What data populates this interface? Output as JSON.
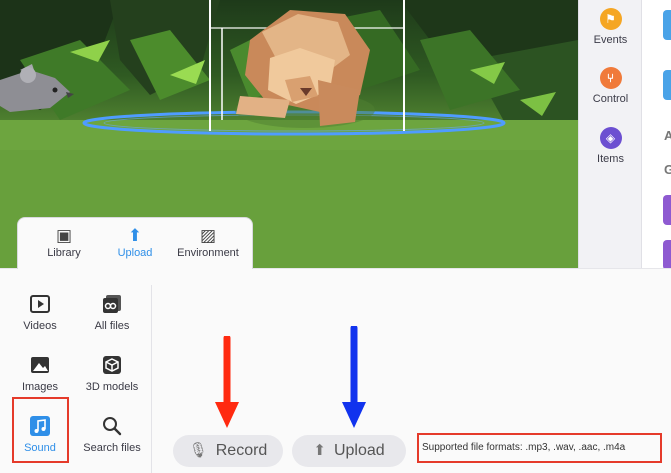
{
  "side_panel": {
    "categories": [
      {
        "label": "Events",
        "icon": "flag-icon",
        "color": "#f5a623"
      },
      {
        "label": "Control",
        "icon": "branch-icon",
        "color": "#f07a3a"
      },
      {
        "label": "Items",
        "icon": "cube-icon",
        "color": "#6c4fd1"
      }
    ],
    "partial_text_a": "A",
    "partial_text_g": "G"
  },
  "tabs": [
    {
      "label": "Library",
      "icon": "library-icon",
      "active": false
    },
    {
      "label": "Upload",
      "icon": "upload-icon",
      "active": true
    },
    {
      "label": "Environment",
      "icon": "environment-icon",
      "active": false
    }
  ],
  "subnav": [
    {
      "label": "Videos",
      "icon": "video-icon"
    },
    {
      "label": "All files",
      "icon": "all-files-icon"
    },
    {
      "label": "Images",
      "icon": "image-icon"
    },
    {
      "label": "3D models",
      "icon": "cube-model-icon"
    },
    {
      "label": "Sound",
      "icon": "music-note-icon",
      "active": true
    },
    {
      "label": "Search files",
      "icon": "search-icon"
    }
  ],
  "actions": {
    "record_label": "Record",
    "upload_label": "Upload"
  },
  "supported_formats": "Supported file formats: .mp3, .wav, .aac, .m4a",
  "colors": {
    "accent_blue": "#2f8fe8",
    "highlight_red": "#e53a2a",
    "annotation_arrow_red": "#ff2a10",
    "annotation_arrow_blue": "#1133ee"
  }
}
